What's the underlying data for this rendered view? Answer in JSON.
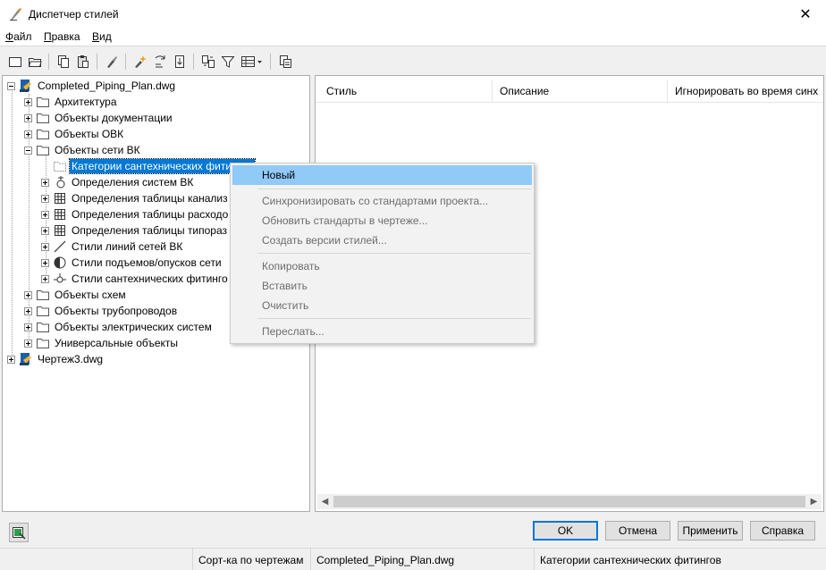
{
  "window": {
    "title": "Диспетчер стилей",
    "close_glyph": "✕"
  },
  "menu": [
    {
      "label": "Файл",
      "accel": "Ф",
      "rest": "айл"
    },
    {
      "label": "Правка",
      "accel": "П",
      "rest": "равка"
    },
    {
      "label": "Вид",
      "accel": "В",
      "rest": "ид"
    }
  ],
  "tree": {
    "root1": "Completed_Piping_Plan.dwg",
    "architecture": "Архитектура",
    "doc_objects": "Объекты документации",
    "hvac_objects": "Объекты ОВК",
    "plumbing_objects": "Объекты сети ВК",
    "plumbing_fitting_categories": "Категории сантехнических фитингов",
    "plumbing_system_defs": "Определения систем ВК",
    "sewer_table_defs": "Определения таблицы канализ",
    "flow_table_defs": "Определения таблицы расходо",
    "size_table_defs": "Определения таблицы типораз",
    "plumbing_line_styles": "Стили линий сетей ВК",
    "riser_styles": "Стили подъемов/опусков сети",
    "fitting_styles": "Стили сантехнических фитинго",
    "schematic_objects": "Объекты схем",
    "piping_objects": "Объекты трубопроводов",
    "electrical_objects": "Объекты электрических систем",
    "multipurpose_objects": "Универсальные объекты",
    "root2": "Чертеж3.dwg"
  },
  "columns": {
    "style": "Стиль",
    "description": "Описание",
    "ignore": "Игнорировать во время синх"
  },
  "context_menu": {
    "new": "Новый",
    "sync": "Синхронизировать со стандартами проекта...",
    "update": "Обновить стандарты в чертеже...",
    "versions": "Создать версии стилей...",
    "copy": "Копировать",
    "paste": "Вставить",
    "purge": "Очистить",
    "email": "Переслать..."
  },
  "buttons": {
    "ok": "OK",
    "cancel": "Отмена",
    "apply": "Применить",
    "help": "Справка"
  },
  "status": {
    "sort": "Сорт-ка по чертежам",
    "drawing": "Completed_Piping_Plan.dwg",
    "selection": "Категории сантехнических фитингов"
  },
  "colors": {
    "selection": "#0078d7",
    "menu_highlight": "#91c9f7",
    "disabled_text": "#6d6d6d"
  }
}
